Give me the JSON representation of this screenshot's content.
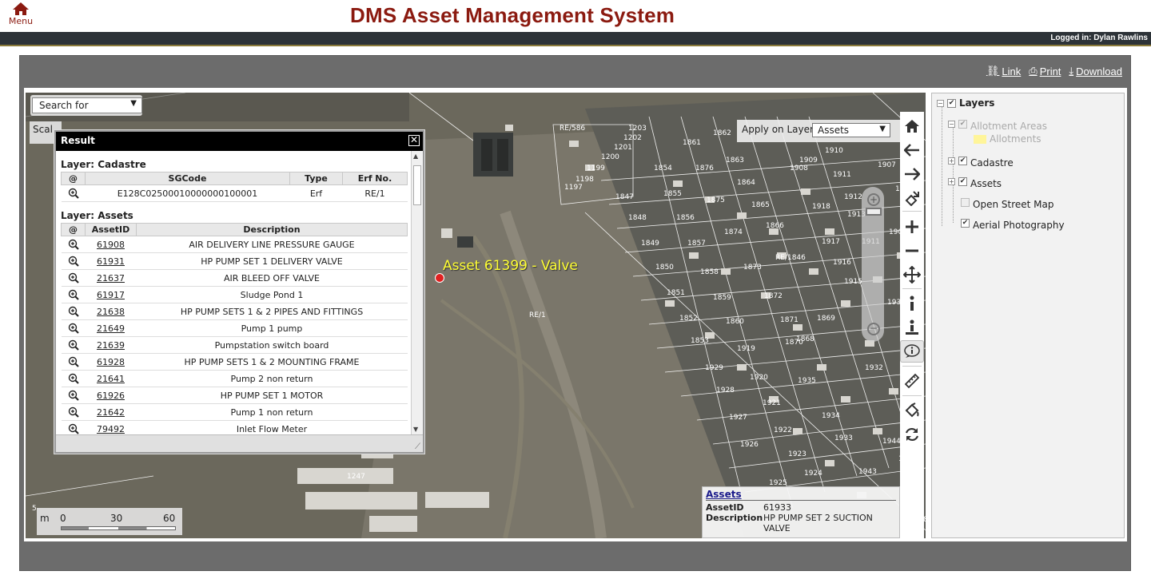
{
  "header": {
    "menu_label": "Menu",
    "app_title": "DMS Asset Management System",
    "logged_in": "Logged in: Dylan Rawlins"
  },
  "toolbar": {
    "link": "Link",
    "print": "Print",
    "download": "Download"
  },
  "map": {
    "search_for": "Search for",
    "scale_tab": "Scal",
    "apply_layer_label": "Apply on Layer",
    "apply_layer_value": "Assets",
    "asset_label": "Asset 61399 - Valve",
    "scalebar": {
      "unit": "m",
      "ticks": [
        "0",
        "30",
        "60"
      ]
    },
    "erf_labels": [
      "RE/586",
      "1203",
      "1202",
      "1201",
      "1200",
      "1199",
      "1198",
      "1197",
      "1862",
      "1861",
      "1876",
      "1863",
      "1854",
      "1847",
      "1855",
      "1864",
      "1875",
      "1848",
      "1856",
      "1865",
      "1849",
      "1857",
      "1874",
      "1866",
      "1850",
      "1858",
      "1873",
      "1851",
      "1859",
      "1872",
      "1852",
      "1860",
      "1871",
      "1853",
      "1919",
      "1870",
      "1929",
      "1920",
      "1928",
      "1921",
      "1927",
      "1922",
      "1926",
      "1923",
      "1925",
      "1924",
      "1910",
      "1909",
      "1911",
      "1907",
      "1906",
      "1912",
      "1913",
      "1905",
      "1918",
      "1917",
      "1904",
      "1916",
      "1915",
      "1911",
      "1931",
      "1869",
      "1868",
      "1932",
      "1935",
      "1934",
      "1933",
      "1944",
      "1943",
      "1946",
      "1947",
      "1948",
      "RE/1846",
      "RE/1",
      "1247",
      "1908",
      "5"
    ]
  },
  "info_popup": {
    "title": "Assets",
    "asset_id_key": "AssetID",
    "asset_id": "61933",
    "desc_key": "Description",
    "desc": "HP PUMP SET 2 SUCTION VALVE"
  },
  "result": {
    "title": "Result",
    "cadastre": {
      "heading": "Layer: Cadastre",
      "columns": [
        "@",
        "SGCode",
        "Type",
        "Erf No."
      ],
      "rows": [
        {
          "sgcode": "E128C02500010000000100001",
          "type": "Erf",
          "erf": "RE/1"
        }
      ]
    },
    "assets": {
      "heading": "Layer: Assets",
      "columns": [
        "@",
        "AssetID",
        "Description"
      ],
      "rows": [
        {
          "id": "61908",
          "desc": "AIR DELIVERY LINE PRESSURE GAUGE"
        },
        {
          "id": "61931",
          "desc": "HP PUMP SET 1 DELIVERY VALVE"
        },
        {
          "id": "21637",
          "desc": "AIR BLEED OFF VALVE"
        },
        {
          "id": "61917",
          "desc": "Sludge Pond 1"
        },
        {
          "id": "21638",
          "desc": "HP PUMP SETS 1 & 2 PIPES AND FITTINGS"
        },
        {
          "id": "21649",
          "desc": "Pump 1 pump"
        },
        {
          "id": "21639",
          "desc": "Pumpstation switch board"
        },
        {
          "id": "61928",
          "desc": "HP PUMP SETS 1 & 2 MOUNTING FRAME"
        },
        {
          "id": "21641",
          "desc": "Pump 2 non return"
        },
        {
          "id": "61926",
          "desc": "HP PUMP SET 1 MOTOR"
        },
        {
          "id": "21642",
          "desc": "Pump 1 non return"
        },
        {
          "id": "79492",
          "desc": "Inlet Flow Meter"
        }
      ]
    }
  },
  "layers": {
    "root": "Layers",
    "items": [
      {
        "label": "Allotment Areas",
        "checked": true,
        "disabled": true
      },
      {
        "label": "Allotments",
        "legend": true
      },
      {
        "label": "Cadastre",
        "checked": true
      },
      {
        "label": "Assets",
        "checked": true
      },
      {
        "label": "Open Street Map",
        "checked": false
      },
      {
        "label": "Aerial Photography",
        "checked": true
      }
    ]
  },
  "tools": [
    "home-icon",
    "back-icon",
    "forward-icon",
    "zoom-extent-icon",
    "zoom-in-icon",
    "zoom-out-icon",
    "pan-icon",
    "identify-icon",
    "identify-layer-icon",
    "info-bubble-icon",
    "measure-icon",
    "clear-icon",
    "refresh-icon"
  ]
}
